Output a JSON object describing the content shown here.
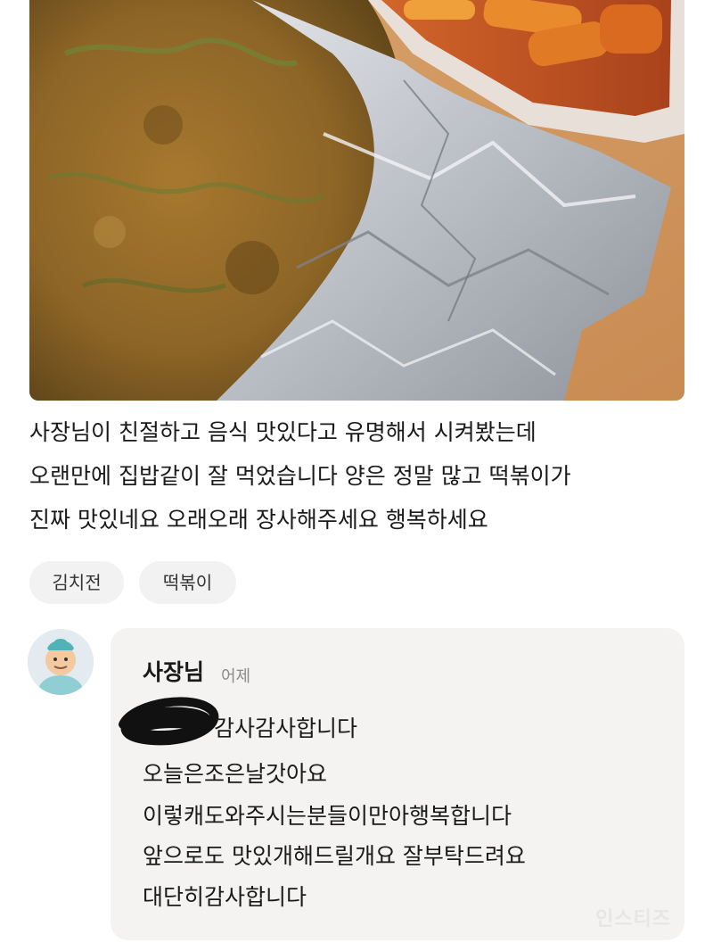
{
  "photo": {
    "alt_icon": "food-photo"
  },
  "review": {
    "lines": [
      "사장님이 친절하고 음식 맛있다고 유명해서 시켜봤는데",
      "오랜만에 집밥같이 잘 먹었습니다 양은 정말 많고 떡볶이가",
      "진짜 맛있네요 오래오래 장사해주세요 행복하세요"
    ]
  },
  "tags": [
    "김치전",
    "떡볶이"
  ],
  "reply": {
    "author": "사장님",
    "time": "어제",
    "lines": [
      "감사감사합니다",
      "오늘은조은날갓아요",
      "이렇캐도와주시는분들이만아행복합니다",
      "앞으로도 맛있개해드릴개요 잘부탁드려요",
      "대단히감사합니다"
    ]
  },
  "watermark": "인스티즈",
  "colors": {
    "bubble": "#f4f3f1",
    "tag_bg": "#f2f2f2",
    "time": "#8a8a8a"
  }
}
